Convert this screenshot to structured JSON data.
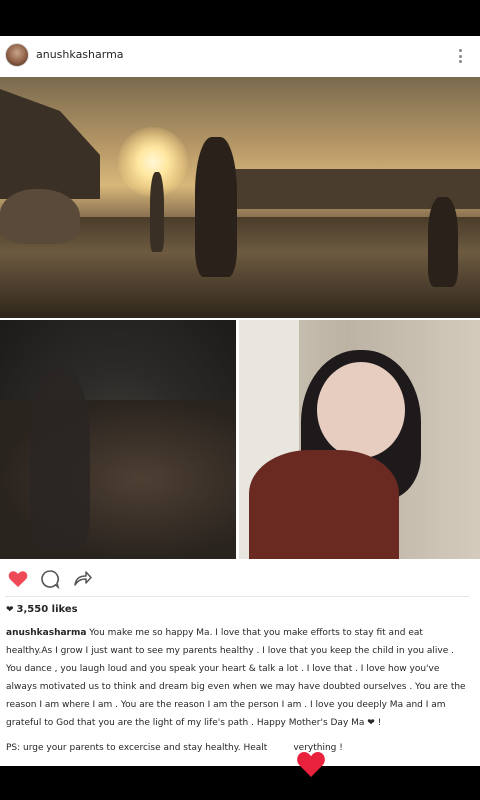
{
  "header": {
    "username": "anushkasharma",
    "more_icon": "more-vertical-icon"
  },
  "actions": {
    "like_icon": "heart-icon",
    "comment_icon": "comment-icon",
    "share_icon": "share-icon",
    "like_color": "#ed4956"
  },
  "likes": {
    "icon": "heart-small-icon",
    "text": "3,550 likes"
  },
  "caption": {
    "username": "anushkasharma",
    "text": " You make me so happy Ma. I love that you make efforts to stay fit and eat healthy.As I  grow I  just want to see my parents healthy . I love that you keep the child in you alive . You dance , you laugh loud and you speak your heart & talk a lot . I love that . I love how you've always motivated us to think and dream big even when we may have doubted ourselves . You are the reason I am where I am . You are the reason I am the person I am . I love you deeply Ma and I am grateful to God that you are the light of my life's path . Happy Mother's Day Ma ",
    "end_heart": "❤",
    "end_text": "   !"
  },
  "ps": {
    "text_before": "PS: urge your parents to excercise and stay healthy. Healt",
    "text_after": "verything !"
  },
  "overlay": {
    "heart_icon": "floating-heart-icon",
    "heart_color": "#e8213c"
  }
}
